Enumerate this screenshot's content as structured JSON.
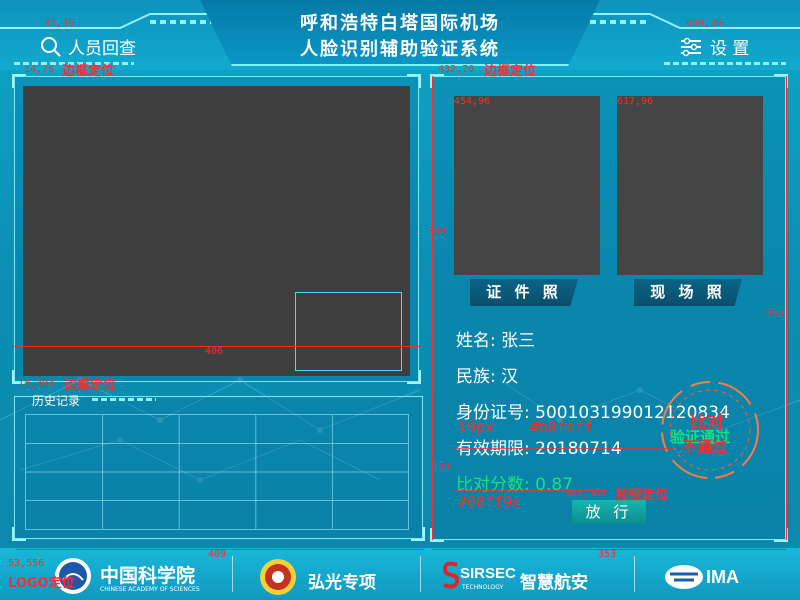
{
  "header": {
    "title_line1": "呼和浩特白塔国际机场",
    "title_line2": "人脸识别辅助验证系统",
    "left_link": "人员回查",
    "right_link": "设 置",
    "left_icon": "search-icon",
    "right_icon": "settings-sliders-icon"
  },
  "panels": {
    "photo_id_label": "证 件 照",
    "photo_scene_label": "现 场 照"
  },
  "person": {
    "name_label": "姓名:",
    "name_value": "张三",
    "ethnicity_label": "民族:",
    "ethnicity_value": "汉",
    "id_label": "身份证号:",
    "id_value": "500103199012120834",
    "expiry_label": "有效期限:",
    "expiry_value": "20180714",
    "score_label": "比对分数:",
    "score_value": "0.87"
  },
  "result": {
    "title": "比对",
    "pass": "验证通过",
    "fail": "不通过"
  },
  "actions": {
    "release_label": "放 行"
  },
  "history": {
    "title": "历史记录",
    "columns": 5,
    "rows": 4
  },
  "footer": {
    "cas_cn": "中国科学院",
    "cas_en": "CHINESE ACADEMY OF SCIENCES",
    "hongguang": "弘光专项",
    "sirsec": "SIRSEC",
    "sirsec_sub": "TECHNOLOGY",
    "smart_aviation": "智慧航安",
    "ima": "IMA"
  },
  "annotations": {
    "a1": "42,36",
    "a2": "680,36",
    "a3": "14,76",
    "a3_text": "边框定位",
    "a4": "432,76",
    "a4_text": "边框定位",
    "a5": "454,96",
    "a6": "617,96",
    "a7": "309",
    "a8": "465",
    "a9": "406",
    "a10": "14,393",
    "a10_text": "边框定位",
    "a11": "149",
    "a12": "563,488",
    "a12_text": "按钮定位",
    "a13": "53,556",
    "a14": "LOGO定位",
    "a15": "409",
    "a16": "353",
    "font_size_note": "19px",
    "color_note_1": "#b0feff",
    "color_note_2": "#00ff9c"
  },
  "colors": {
    "accent": "#7fe9ff",
    "pass_green": "#19e27a",
    "annotation_red": "#ff2b2b",
    "video_bg": "#3f3f3f"
  }
}
